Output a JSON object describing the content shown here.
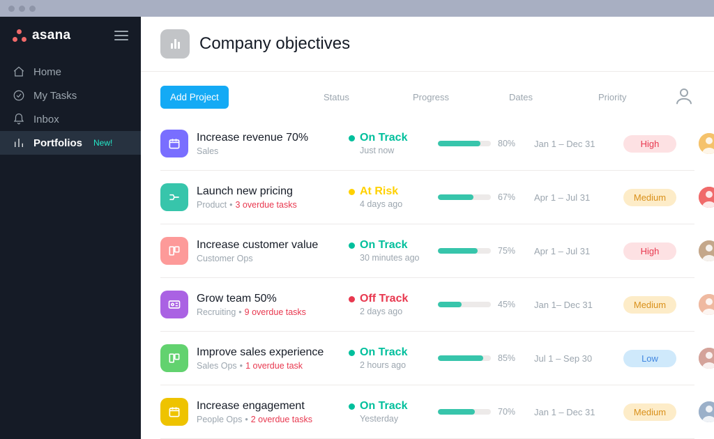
{
  "brand": {
    "name": "asana"
  },
  "sidebar": {
    "items": [
      {
        "icon": "home-icon",
        "label": "Home",
        "badge": "",
        "active": false
      },
      {
        "icon": "check-icon",
        "label": "My Tasks",
        "badge": "",
        "active": false
      },
      {
        "icon": "bell-icon",
        "label": "Inbox",
        "badge": "",
        "active": false
      },
      {
        "icon": "bars-icon",
        "label": "Portfolios",
        "badge": "New!",
        "active": true
      }
    ]
  },
  "header": {
    "title": "Company objectives"
  },
  "toolbar": {
    "add_project_label": "Add Project"
  },
  "columns": {
    "status": "Status",
    "progress": "Progress",
    "dates": "Dates",
    "priority": "Priority"
  },
  "status_labels": {
    "on_track": "On Track",
    "at_risk": "At Risk",
    "off_track": "Off Track"
  },
  "status_colors": {
    "on_track": "#00bf9c",
    "at_risk": "#ffd100",
    "off_track": "#e8384f"
  },
  "priority_styles": {
    "High": {
      "bg": "#fde1e3",
      "fg": "#e8384f"
    },
    "Medium": {
      "bg": "#fdecc8",
      "fg": "#d9901a"
    },
    "Low": {
      "bg": "#cfe9fb",
      "fg": "#4186e0"
    }
  },
  "projects": [
    {
      "icon_color": "#796eff",
      "icon": "calendar",
      "title": "Increase revenue 70%",
      "category": "Sales",
      "overdue": "",
      "status_key": "on_track",
      "status_sub": "Just now",
      "progress_pct": 80,
      "progress_label": "80%",
      "dates": "Jan 1 – Dec 31",
      "priority": "High",
      "avatar_bg": "#f5c26b"
    },
    {
      "icon_color": "#37c5ab",
      "icon": "flow",
      "title": "Launch new pricing",
      "category": "Product",
      "overdue": "3 overdue tasks",
      "status_key": "at_risk",
      "status_sub": "4 days ago",
      "progress_pct": 67,
      "progress_label": "67%",
      "dates": "Apr 1 – Jul 31",
      "priority": "Medium",
      "avatar_bg": "#f06a6a"
    },
    {
      "icon_color": "#fd9a99",
      "icon": "board",
      "title": "Increase customer value",
      "category": "Customer Ops",
      "overdue": "",
      "status_key": "on_track",
      "status_sub": "30 minutes ago",
      "progress_pct": 75,
      "progress_label": "75%",
      "dates": "Apr 1 – Jul 31",
      "priority": "High",
      "avatar_bg": "#c4a78a"
    },
    {
      "icon_color": "#aa62e3",
      "icon": "id",
      "title": "Grow team 50%",
      "category": "Recruiting",
      "overdue": "9 overdue tasks",
      "status_key": "off_track",
      "status_sub": "2 days ago",
      "progress_pct": 45,
      "progress_label": "45%",
      "dates": "Jan 1– Dec 31",
      "priority": "Medium",
      "avatar_bg": "#efb9a0"
    },
    {
      "icon_color": "#62d26f",
      "icon": "board",
      "title": "Improve sales experience",
      "category": "Sales Ops",
      "overdue": "1 overdue task",
      "status_key": "on_track",
      "status_sub": "2 hours ago",
      "progress_pct": 85,
      "progress_label": "85%",
      "dates": "Jul 1 – Sep 30",
      "priority": "Low",
      "avatar_bg": "#d4a39a"
    },
    {
      "icon_color": "#eec300",
      "icon": "calendar",
      "title": "Increase engagement",
      "category": "People Ops",
      "overdue": "2 overdue tasks",
      "status_key": "on_track",
      "status_sub": "Yesterday",
      "progress_pct": 70,
      "progress_label": "70%",
      "dates": "Jan 1 – Dec 31",
      "priority": "Medium",
      "avatar_bg": "#9bb0c9"
    }
  ]
}
